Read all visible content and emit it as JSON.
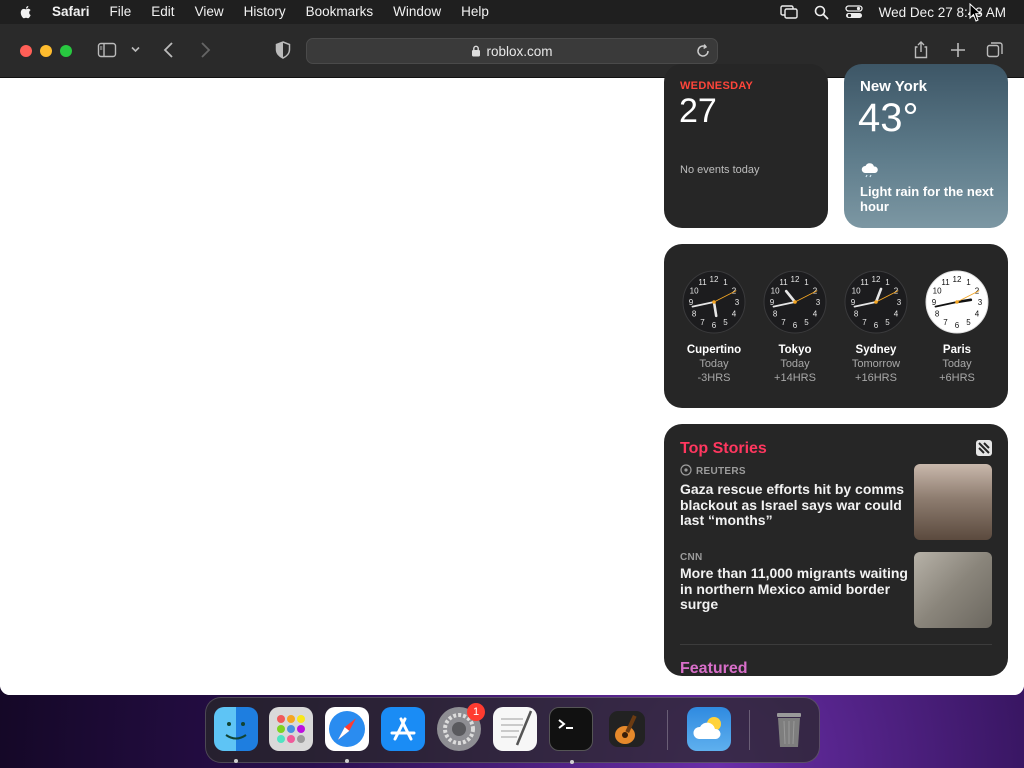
{
  "menubar": {
    "app_name": "Safari",
    "items": [
      "File",
      "Edit",
      "View",
      "History",
      "Bookmarks",
      "Window",
      "Help"
    ],
    "clock": "Wed Dec 27  8:43 AM"
  },
  "browser": {
    "url": "roblox.com"
  },
  "calendar_widget": {
    "weekday": "WEDNESDAY",
    "date": "27",
    "events": "No events today"
  },
  "weather_widget": {
    "city": "New York",
    "temperature": "43°",
    "condition": "Light rain for the next hour"
  },
  "world_clock_widget": {
    "cities": [
      {
        "name": "Cupertino",
        "day": "Today",
        "offset": "-3HRS",
        "hour": 5.7,
        "minute": 43,
        "theme": "dark"
      },
      {
        "name": "Tokyo",
        "day": "Today",
        "offset": "+14HRS",
        "hour": 10.7,
        "minute": 43,
        "theme": "dark"
      },
      {
        "name": "Sydney",
        "day": "Tomorrow",
        "offset": "+16HRS",
        "hour": 0.7,
        "minute": 43,
        "theme": "dark"
      },
      {
        "name": "Paris",
        "day": "Today",
        "offset": "+6HRS",
        "hour": 2.7,
        "minute": 43,
        "theme": "light"
      }
    ]
  },
  "news_widget": {
    "title": "Top Stories",
    "stories": [
      {
        "source": "REUTERS",
        "headline": "Gaza rescue efforts hit by comms blackout as Israel says war could last “months”"
      },
      {
        "source": "CNN",
        "headline": "More than 11,000 migrants waiting in northern Mexico amid border surge"
      }
    ],
    "next_section": "Featured"
  },
  "dock": {
    "apps": [
      "Finder",
      "Launchpad",
      "Safari",
      "App Store",
      "System Settings",
      "TextEdit",
      "Terminal",
      "GarageBand",
      "Weather",
      "Trash"
    ],
    "system_settings_badge": "1"
  },
  "colors": {
    "calendar_red": "#ff453a",
    "news_pink": "#ff375f",
    "toolbar": "#2a2a2a"
  }
}
